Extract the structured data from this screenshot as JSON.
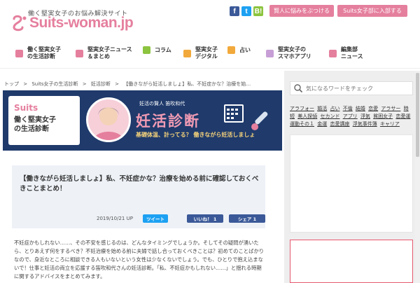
{
  "header": {
    "tagline": "働く堅実女子のお悩み解決サイト",
    "logo": "Suits-woman.jp",
    "social": {
      "facebook": "f",
      "twitter": "t",
      "hatena": "B!"
    },
    "consult_button": "賢人に悩みをぶつける",
    "join_button": "Suits女子部に入部する"
  },
  "nav": {
    "items": [
      {
        "label": "働く堅実女子\nの生活診断",
        "icon": "stethoscope-icon",
        "color": "#e57f9e"
      },
      {
        "label": "堅実女子ニュース\n＆まとめ",
        "icon": "news-icon",
        "color": "#e57f9e"
      },
      {
        "label": "コラム",
        "icon": "column-icon",
        "color": "#8cc43f"
      },
      {
        "label": "堅実女子\nデジタル",
        "icon": "digital-icon",
        "color": "#f2a93b"
      },
      {
        "label": "占い",
        "icon": "fortune-icon",
        "color": "#f2a93b"
      },
      {
        "label": "堅実女子の\nスマホアプリ",
        "icon": "smartphone-icon",
        "color": "#c79fd6"
      },
      {
        "label": "編集部\nニュース",
        "icon": "editorial-icon",
        "color": "#e57f9e"
      }
    ]
  },
  "breadcrumb": [
    "トップ",
    ">",
    "Suits女子の生活診断",
    ">",
    "妊活診断",
    ">",
    "【働きながら妊活しましょ】私、不妊症かな？治療を始…"
  ],
  "banner": {
    "logo": "Suits",
    "subtitle": "働く堅実女子\nの生活診断",
    "expert": "妊活の賢人  笛吹和代",
    "title": "妊活診断",
    "catch": "基礎体温、計ってる？ 働きながら妊活しましょ"
  },
  "article": {
    "title": "【働きながら妊活しましょ】私、不妊症かな？治療を始める前に確認しておくべきことまとめ！",
    "date": "2019/10/21  UP",
    "tweet": "ツイート",
    "like": "いいね！ 1",
    "share": "シェア 1",
    "body": "不妊症かもしれない……、その不安を感じるのは、どんなタイミングでしょうか。そしてその疑問が湧いたら、とりあえず何をするべき？不妊治療を始める前に夫婦で話し合っておくべきことは？初めてのことばかりなので、身近なところに相談できる人もいないという女性は少なくないでしょう。でも、ひとりで抱え込まないで！仕事と妊活の両立を応援する笛吹和代さんの妊活診断。「私、不妊症かもしれない……」と揺れる時期に関するアドバイスをまとめてみます。"
  },
  "sidebar": {
    "search_placeholder": "気になるワードをチェック",
    "tags": [
      "アラフォー",
      "婚活",
      "占い",
      "不倫",
      "結婚",
      "恋愛",
      "アラサー",
      "時短",
      "美人探偵",
      "セカンド",
      "アプリ",
      "浮気",
      "貧困女子",
      "恋愛運",
      "運動その１",
      "金運",
      "恋愛講座",
      "浮気事件簿",
      "キャリア"
    ]
  },
  "colors": {
    "accent": "#e57f9e",
    "banner_bg": "#1f3a6b",
    "banner_title": "#f19bb4"
  }
}
